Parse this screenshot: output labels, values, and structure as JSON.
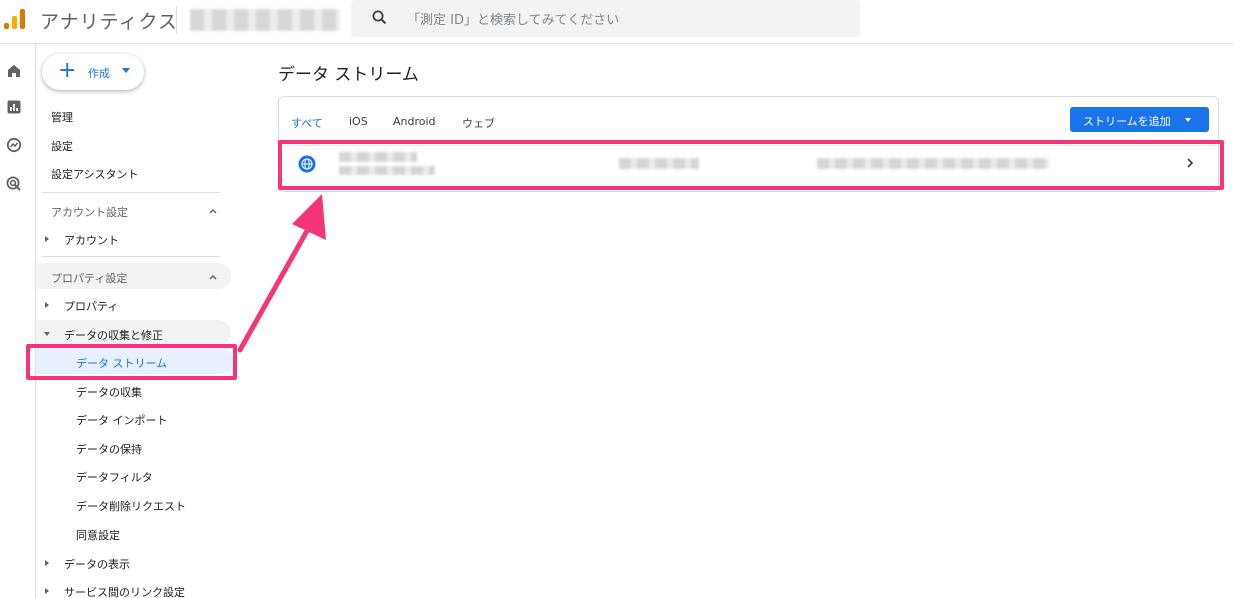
{
  "header": {
    "app_title": "アナリティクス",
    "search_placeholder": "「測定 ID」と検索してみてください"
  },
  "rail": {
    "icons": [
      "home-icon",
      "reports-icon",
      "explore-icon",
      "advertising-icon"
    ]
  },
  "sidebar": {
    "create_label": "作成",
    "items": {
      "admin": "管理",
      "settings": "設定",
      "setup_assistant": "設定アシスタント"
    },
    "account_section": {
      "title": "アカウント設定",
      "items": [
        "アカウント"
      ]
    },
    "property_section": {
      "title": "プロパティ設定",
      "property": "プロパティ",
      "data_collection": {
        "title": "データの収集と修正",
        "items": [
          "データ ストリーム",
          "データの収集",
          "データ インポート",
          "データの保持",
          "データフィルタ",
          "データ削除リクエスト",
          "同意設定"
        ]
      },
      "data_display": "データの表示",
      "service_links": "サービス間のリンク設定"
    }
  },
  "main": {
    "title": "データ ストリーム",
    "tabs": [
      "すべて",
      "iOS",
      "Android",
      "ウェブ"
    ],
    "add_stream_label": "ストリームを追加",
    "row_chevron": ">"
  },
  "colors": {
    "accent": "#1a73e8",
    "highlight": "#f5357a",
    "active_bg": "#e8f0fe"
  }
}
